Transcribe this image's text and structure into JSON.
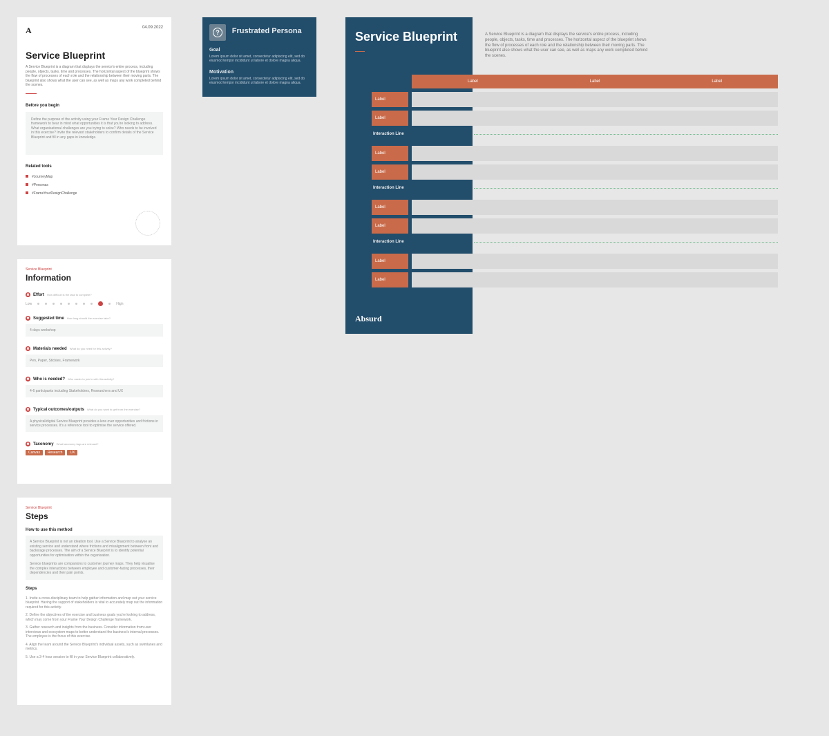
{
  "overview": {
    "logo": "A",
    "date": "04.09.2022",
    "title": "Service Blueprint",
    "description": "A Service Blueprint is a diagram that displays the service's entire process, including people, objects, tasks, time and processes. The horizontal aspect of the blueprint shows the flow of processes of each role and the relationship between their moving parts. The blueprint also shows what the user can see, as well as maps any work completed behind the scenes.",
    "before_title": "Before you begin",
    "before_text": "Define the purpose of the activity using your Frame Your Design Challenge framework to bear in mind what opportunities it is that you're looking to address. What organisational challenges are you trying to solve? Who needs to be involved in this exercise? Invite the relevant stakeholders to confirm details of the Service Blueprint and fill in any gaps in knowledge.",
    "related_title": "Related tools",
    "related": [
      "#JourneyMap",
      "#Personas",
      "#FrameYourDesignChallenge"
    ]
  },
  "info": {
    "eyebrow": "Service Blueprint",
    "title": "Information",
    "effort": {
      "label": "Effort",
      "hint": "How difficult is the task to complete?",
      "low": "Low",
      "high": "High",
      "value": 9,
      "max": 10
    },
    "time": {
      "label": "Suggested time",
      "hint": "How long should the exercise take?",
      "value": "4 days workshop"
    },
    "materials": {
      "label": "Materials needed",
      "hint": "What do you need for this activity?",
      "value": "Pen, Paper, Stickies, Framework"
    },
    "who": {
      "label": "Who is needed?",
      "hint": "Who needs to join in with this activity?",
      "value": "4-6 participants including Stakeholders, Researchers and UX"
    },
    "outcomes": {
      "label": "Typical outcomes/outputs",
      "hint": "What do you want to get from the exercise?",
      "value": "A physical/digital Service Blueprint provides a lens over opportunities and frictions in service processes. It's a reference tool to optimise the service offered."
    },
    "taxonomy": {
      "label": "Taxonomy",
      "hint": "What taxonomy tags are relevant?",
      "tags": [
        "Canvas",
        "Research",
        "UX"
      ]
    }
  },
  "steps": {
    "eyebrow": "Service Blueprint",
    "title": "Steps",
    "howto_title": "How to use this method",
    "howto_p1": "A Service Blueprint is not an ideation tool. Use a Service Blueprint to analyse an existing service and understand where frictions and misalignment between front and backstage processes. The aim of a Service Blueprint is to identify potential opportunities for optimisation within the organisation.",
    "howto_p2": "Service blueprints are companions to customer journey maps. They help visualise the complex interactions between employee and customer-facing processes, their dependencies and their pain points.",
    "steps_title": "Steps",
    "items": [
      "1. Invite a cross-disciplinary team to help gather information and map out your service blueprint. Having the support of stakeholders is vital to accurately map out the information required for this activity.",
      "2. Define the objectives of the exercise and business goals you're looking to address, which may come from your Frame Your Design Challenge framework.",
      "3. Gather research and insights from the business. Consider information from user interviews and ecosystem maps to better understand the business's internal processes. The employee is the focus of this exercise.",
      "4. Align the team around the Service Blueprint's individual assets, such as swimlanes and metrics.",
      "5. Use a 3-4 hour session to fill in your Service Blueprint collaboratively."
    ]
  },
  "persona": {
    "title": "Frustrated Persona",
    "icon": "?",
    "goal_label": "Goal",
    "goal_text": "Lorem ipsum dolor sit amet, consectetur adipiscing elit, sed do eiusmod tempor incididunt ut labore et dolore magna aliqua.",
    "motivation_label": "Motivation",
    "motivation_text": "Lorem ipsum dolor sit amet, consectetur adipiscing elit, sed do eiusmod tempor incididunt ut labore et dolore magna aliqua."
  },
  "blueprint": {
    "title": "Service Blueprint",
    "brand": "Absurd",
    "description": "A Service Blueprint is a diagram that displays the service's entire process, including people, objects, tasks, time and processes. The horizontal aspect of the blueprint shows the flow of processes of each role and the relationship between their moving parts. The blueprint also shows what the user can see, as well as maps any work completed behind the scenes.",
    "col_labels": [
      "Label",
      "Label",
      "Label"
    ],
    "row_label": "Label",
    "interaction_label": "Interaction Line",
    "sections": 4
  }
}
